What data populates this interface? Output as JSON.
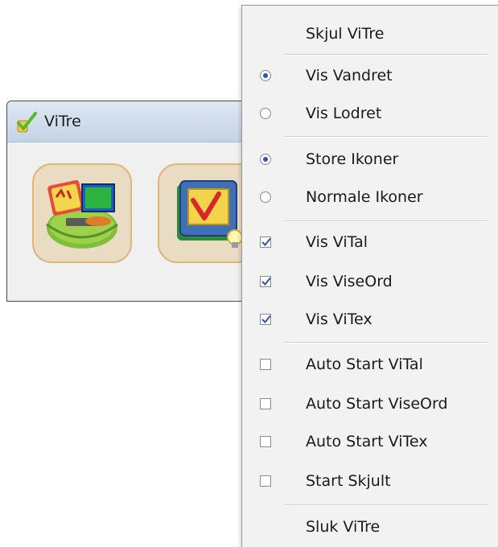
{
  "window": {
    "title": "ViTre",
    "app_icon": "vitre-checkmark-icon",
    "buttons": [
      {
        "name": "vital-launcher",
        "icon": "vital-math-icon"
      },
      {
        "name": "viseord-launcher",
        "icon": "viseord-book-icon"
      }
    ]
  },
  "menu": {
    "hide": "Skjul ViTre",
    "show_horizontal": "Vis Vandret",
    "show_vertical": "Vis Lodret",
    "large_icons": "Store Ikoner",
    "normal_icons": "Normale Ikoner",
    "show_vital": "Vis ViTal",
    "show_viseord": "Vis ViseOrd",
    "show_vitex": "Vis ViTex",
    "autostart_vital": "Auto Start ViTal",
    "autostart_viseord": "Auto Start ViseOrd",
    "autostart_vitex": "Auto Start ViTex",
    "start_hidden": "Start Skjult",
    "close": "Sluk ViTre",
    "state": {
      "orientation": "Vis Vandret",
      "icon_size": "Store Ikoner",
      "show_vital": true,
      "show_viseord": true,
      "show_vitex": true,
      "autostart_vital": false,
      "autostart_viseord": false,
      "autostart_vitex": false,
      "start_hidden": false
    }
  },
  "colors": {
    "accent_blue": "#2a57b8",
    "menu_bg": "#f2f2f2",
    "titlebar": "#c4d3e6",
    "button_border": "#e0b57a"
  }
}
